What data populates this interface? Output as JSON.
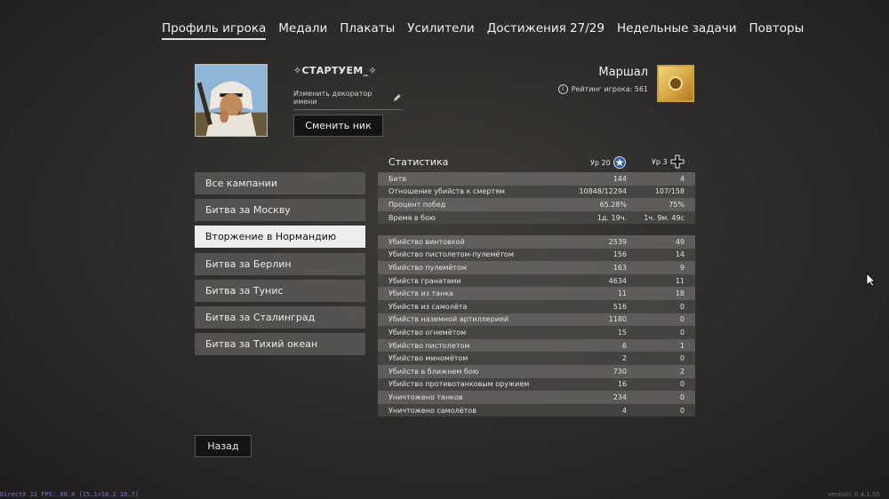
{
  "nav": {
    "tabs": [
      {
        "label": "Профиль игрока",
        "active": true
      },
      {
        "label": "Медали"
      },
      {
        "label": "Плакаты"
      },
      {
        "label": "Усилители"
      },
      {
        "label": "Достижения 27/29"
      },
      {
        "label": "Недельные задачи"
      },
      {
        "label": "Повторы"
      }
    ]
  },
  "profile": {
    "nickname": "✧СТАРТУЕМ_✧",
    "decorator_link": "Изменить декоратор имени",
    "change_nick_button": "Сменить ник",
    "rank_title": "Маршал",
    "rating_text": "Рейтинг игрока: 561",
    "rank_color": "#d6a742"
  },
  "campaigns": [
    {
      "label": "Все кампании"
    },
    {
      "label": "Битва за Москву"
    },
    {
      "label": "Вторжение в Нормандию",
      "active": true
    },
    {
      "label": "Битва за Берлин"
    },
    {
      "label": "Битва за Тунис"
    },
    {
      "label": "Битва за Сталинград"
    },
    {
      "label": "Битва за Тихий океан"
    }
  ],
  "stats": {
    "title": "Статистика",
    "level1": "Ур 20",
    "level2": "Ур 3",
    "summary": [
      {
        "label": "Битв",
        "v1": "144",
        "v2": "4"
      },
      {
        "label": "Отношение убийств к смертям",
        "v1": "10848/12294",
        "v2": "107/158"
      },
      {
        "label": "Процент побед",
        "v1": "65.28%",
        "v2": "75%"
      },
      {
        "label": "Время в бою",
        "v1": "1д. 19ч.",
        "v2": "1ч. 9м. 49с"
      }
    ],
    "kills": [
      {
        "label": "Убийство винтовкой",
        "v1": "2539",
        "v2": "49"
      },
      {
        "label": "Убийство пистолетом-пулемётом",
        "v1": "156",
        "v2": "14"
      },
      {
        "label": "Убийство пулемётом",
        "v1": "163",
        "v2": "9"
      },
      {
        "label": "Убийств гранатами",
        "v1": "4634",
        "v2": "11"
      },
      {
        "label": "Убийств из танка",
        "v1": "11",
        "v2": "18"
      },
      {
        "label": "Убийств из самолёта",
        "v1": "516",
        "v2": "0"
      },
      {
        "label": "Убийств наземной артиллерией",
        "v1": "1180",
        "v2": "0"
      },
      {
        "label": "Убийство огнемётом",
        "v1": "15",
        "v2": "0"
      },
      {
        "label": "Убийство пистолетом",
        "v1": "6",
        "v2": "1"
      },
      {
        "label": "Убийство миномётом",
        "v1": "2",
        "v2": "0"
      },
      {
        "label": "Убийств в ближнем бою",
        "v1": "730",
        "v2": "2"
      },
      {
        "label": "Убийство противотанковым оружием",
        "v1": "16",
        "v2": "0"
      },
      {
        "label": "Уничтожено танков",
        "v1": "234",
        "v2": "0"
      },
      {
        "label": "Уничтожено самолётов",
        "v1": "4",
        "v2": "0"
      }
    ]
  },
  "back_button": "Назад",
  "footer": {
    "fps": "DirectX 11 FPS: 60.0 (15.1<18.2 16.7)",
    "version": "version: 0.4.1.55"
  }
}
